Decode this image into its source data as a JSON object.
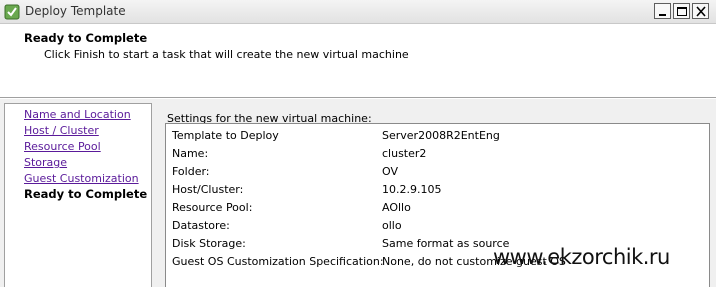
{
  "window": {
    "title": "Deploy Template",
    "icon": "vsphere-template-icon"
  },
  "header": {
    "title": "Ready to Complete",
    "subtitle": "Click Finish to start a task that will create the new virtual machine"
  },
  "nav": {
    "items": [
      {
        "label": "Name and Location",
        "state": "link"
      },
      {
        "label": "Host / Cluster",
        "state": "link"
      },
      {
        "label": "Resource Pool",
        "state": "link"
      },
      {
        "label": "Storage",
        "state": "link"
      },
      {
        "label": "Guest Customization",
        "state": "link"
      },
      {
        "label": "Ready to Complete",
        "state": "current"
      }
    ]
  },
  "settings": {
    "heading": "Settings for the new virtual machine:",
    "rows": [
      {
        "label": "Template to Deploy",
        "value": "Server2008R2EntEng"
      },
      {
        "label": "Name:",
        "value": "cluster2"
      },
      {
        "label": "Folder:",
        "value": "OV"
      },
      {
        "label": "Host/Cluster:",
        "value": "10.2.9.105"
      },
      {
        "label": "Resource Pool:",
        "value": "AOllo"
      },
      {
        "label": "Datastore:",
        "value": "ollo"
      },
      {
        "label": "Disk Storage:",
        "value": "Same format as source"
      },
      {
        "label": "Guest OS Customization Specification:",
        "value": "None, do not customize guest OS"
      }
    ]
  },
  "watermark": "www.ekzorchik.ru",
  "colors": {
    "link": "#5a1a9a",
    "titlebar": "#e8e8e8",
    "panel_bg": "#f0f0f0"
  }
}
